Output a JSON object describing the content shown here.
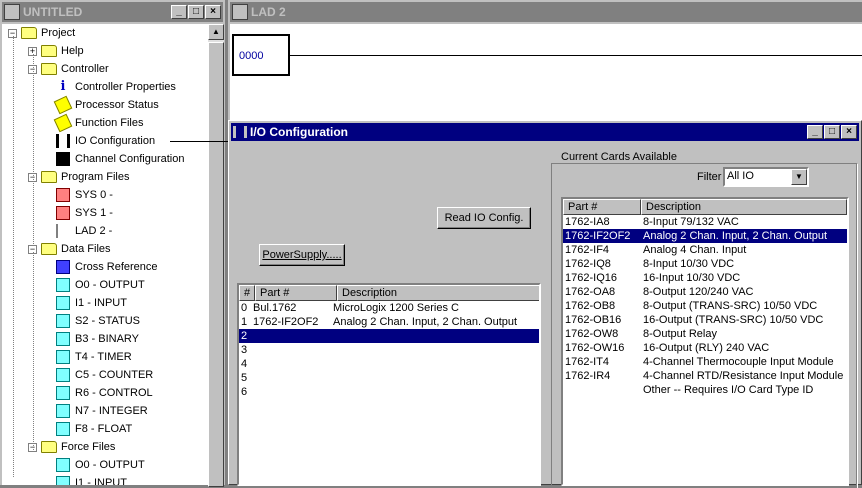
{
  "project_window": {
    "title": "UNTITLED",
    "buttons": [
      "_",
      "□",
      "×"
    ],
    "tree": [
      {
        "label": "Project",
        "level": 0,
        "expander": "−",
        "icon": "folder-icon"
      },
      {
        "label": "Help",
        "level": 1,
        "expander": "+",
        "icon": "folder-icon"
      },
      {
        "label": "Controller",
        "level": 1,
        "expander": "−",
        "icon": "folder-icon"
      },
      {
        "label": "Controller Properties",
        "level": 2,
        "icon": "info-icon"
      },
      {
        "label": "Processor Status",
        "level": 2,
        "icon": "tag-icon"
      },
      {
        "label": "Function Files",
        "level": 2,
        "icon": "tag-icon"
      },
      {
        "label": "IO Configuration",
        "level": 2,
        "icon": "io-icon"
      },
      {
        "label": "Channel Configuration",
        "level": 2,
        "icon": "channel-icon"
      },
      {
        "label": "Program Files",
        "level": 1,
        "expander": "−",
        "icon": "folder-icon"
      },
      {
        "label": "SYS 0 -",
        "level": 2,
        "icon": "program-file-icon"
      },
      {
        "label": "SYS 1 -",
        "level": 2,
        "icon": "program-file-icon"
      },
      {
        "label": "LAD 2 -",
        "level": 2,
        "icon": "ladder-icon"
      },
      {
        "label": "Data Files",
        "level": 1,
        "expander": "−",
        "icon": "folder-icon"
      },
      {
        "label": "Cross Reference",
        "level": 2,
        "icon": "cross-reference-icon"
      },
      {
        "label": "O0 - OUTPUT",
        "level": 2,
        "icon": "data-file-icon"
      },
      {
        "label": "I1 - INPUT",
        "level": 2,
        "icon": "data-file-icon"
      },
      {
        "label": "S2 - STATUS",
        "level": 2,
        "icon": "data-file-icon"
      },
      {
        "label": "B3 - BINARY",
        "level": 2,
        "icon": "data-file-icon"
      },
      {
        "label": "T4 - TIMER",
        "level": 2,
        "icon": "data-file-icon"
      },
      {
        "label": "C5 - COUNTER",
        "level": 2,
        "icon": "data-file-icon"
      },
      {
        "label": "R6 - CONTROL",
        "level": 2,
        "icon": "data-file-icon"
      },
      {
        "label": "N7 - INTEGER",
        "level": 2,
        "icon": "data-file-icon"
      },
      {
        "label": "F8 - FLOAT",
        "level": 2,
        "icon": "data-file-icon"
      },
      {
        "label": "Force Files",
        "level": 1,
        "expander": "−",
        "icon": "folder-icon"
      },
      {
        "label": "O0 - OUTPUT",
        "level": 2,
        "icon": "data-file-icon"
      },
      {
        "label": "I1 - INPUT",
        "level": 2,
        "icon": "data-file-icon"
      }
    ]
  },
  "ladder_window": {
    "title": "LAD 2",
    "rung_number": "0000"
  },
  "io_dialog": {
    "title": "I/O Configuration",
    "read_button": "Read IO Config.",
    "power_button": "PowerSupply.....",
    "slots_table": {
      "headers": [
        "#",
        "Part #",
        "Description"
      ],
      "rows": [
        {
          "slot": "0",
          "part": "Bul.1762",
          "desc": "MicroLogix 1200 Series C",
          "selected": false
        },
        {
          "slot": "1",
          "part": "1762-IF2OF2",
          "desc": "Analog 2 Chan. Input, 2 Chan. Output",
          "selected": false
        },
        {
          "slot": "2",
          "part": "",
          "desc": "",
          "selected": true
        },
        {
          "slot": "3",
          "part": "",
          "desc": "",
          "selected": false
        },
        {
          "slot": "4",
          "part": "",
          "desc": "",
          "selected": false
        },
        {
          "slot": "5",
          "part": "",
          "desc": "",
          "selected": false
        },
        {
          "slot": "6",
          "part": "",
          "desc": "",
          "selected": false
        }
      ]
    },
    "current_cards": {
      "group_label": "Current Cards Available",
      "filter_label": "Filter",
      "filter_value": "All IO",
      "headers": [
        "Part #",
        "Description"
      ],
      "rows": [
        {
          "part": "1762-IA8",
          "desc": "8-Input 79/132 VAC",
          "selected": false
        },
        {
          "part": "1762-IF2OF2",
          "desc": "Analog 2 Chan. Input, 2 Chan. Output",
          "selected": true
        },
        {
          "part": "1762-IF4",
          "desc": "Analog 4 Chan. Input",
          "selected": false
        },
        {
          "part": "1762-IQ8",
          "desc": "8-Input 10/30 VDC",
          "selected": false
        },
        {
          "part": "1762-IQ16",
          "desc": "16-Input 10/30 VDC",
          "selected": false
        },
        {
          "part": "1762-OA8",
          "desc": "8-Output 120/240 VAC",
          "selected": false
        },
        {
          "part": "1762-OB8",
          "desc": " 8-Output (TRANS-SRC) 10/50 VDC",
          "selected": false
        },
        {
          "part": "1762-OB16",
          "desc": "16-Output (TRANS-SRC) 10/50 VDC",
          "selected": false
        },
        {
          "part": "1762-OW8",
          "desc": "8-Output Relay",
          "selected": false
        },
        {
          "part": "1762-OW16",
          "desc": "16-Output (RLY) 240 VAC",
          "selected": false
        },
        {
          "part": "1762-IT4",
          "desc": "4-Channel Thermocouple Input Module",
          "selected": false
        },
        {
          "part": "1762-IR4",
          "desc": "4-Channel RTD/Resistance Input Module",
          "selected": false
        },
        {
          "part": "",
          "desc": "Other -- Requires I/O Card Type ID",
          "selected": false
        }
      ]
    }
  }
}
